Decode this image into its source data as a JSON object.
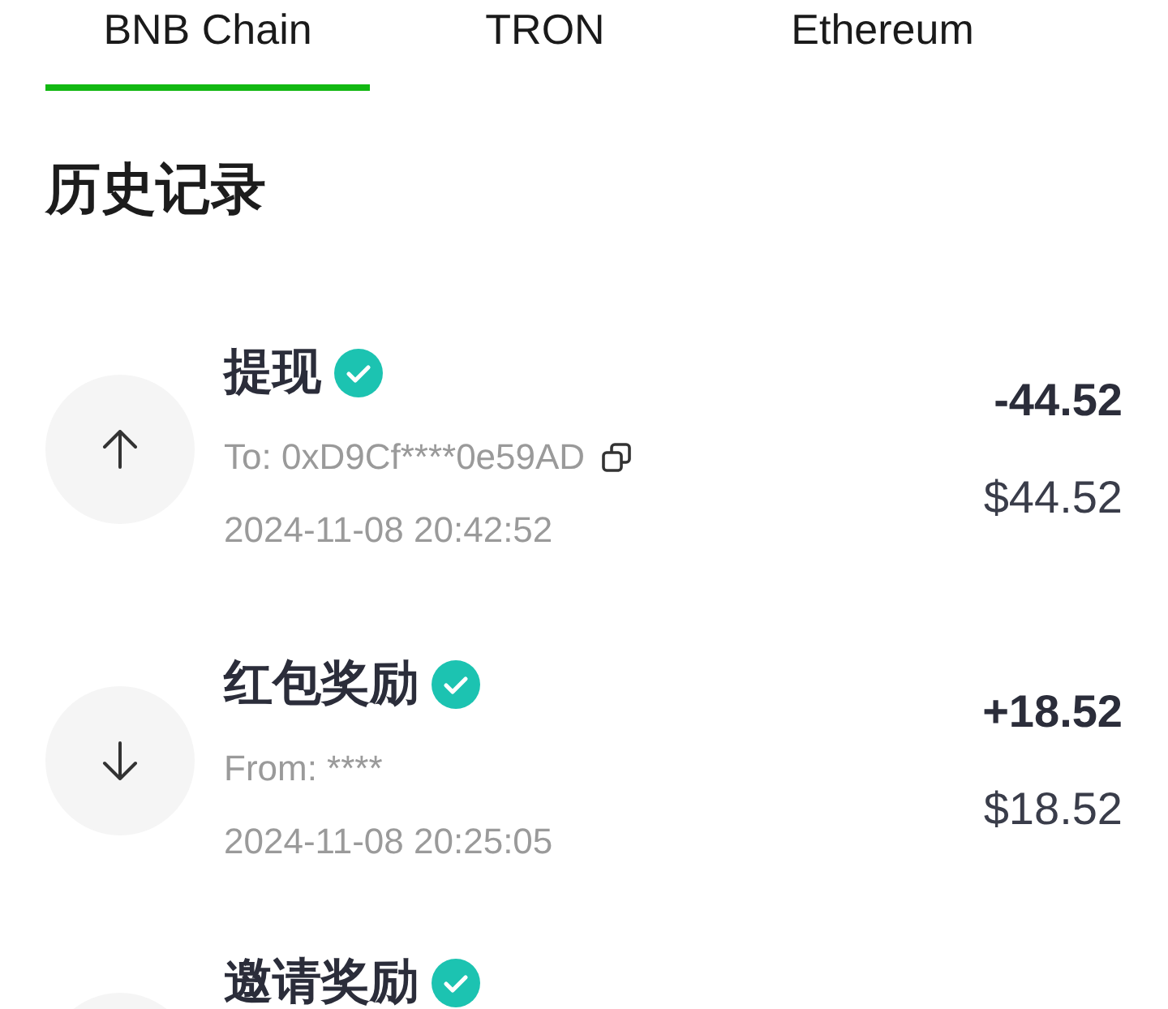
{
  "tabs": [
    {
      "label": "BNB Chain",
      "selected": true
    },
    {
      "label": "TRON",
      "selected": false
    },
    {
      "label": "Ethereum",
      "selected": false
    }
  ],
  "history": {
    "title": "历史记录",
    "records": [
      {
        "kind": "outgoing",
        "title": "提现",
        "verified": true,
        "counterparty": "To: 0xD9Cf****0e59AD",
        "copyable": true,
        "time": "2024-11-08 20:42:52",
        "amount": "-44.52",
        "usd_value": "$44.52"
      },
      {
        "kind": "incoming",
        "title": "红包奖励",
        "verified": true,
        "counterparty": "From: ****",
        "copyable": false,
        "time": "2024-11-08 20:25:05",
        "amount": "+18.52",
        "usd_value": "$18.52"
      },
      {
        "title": "邀请奖励",
        "verified": true
      }
    ]
  }
}
